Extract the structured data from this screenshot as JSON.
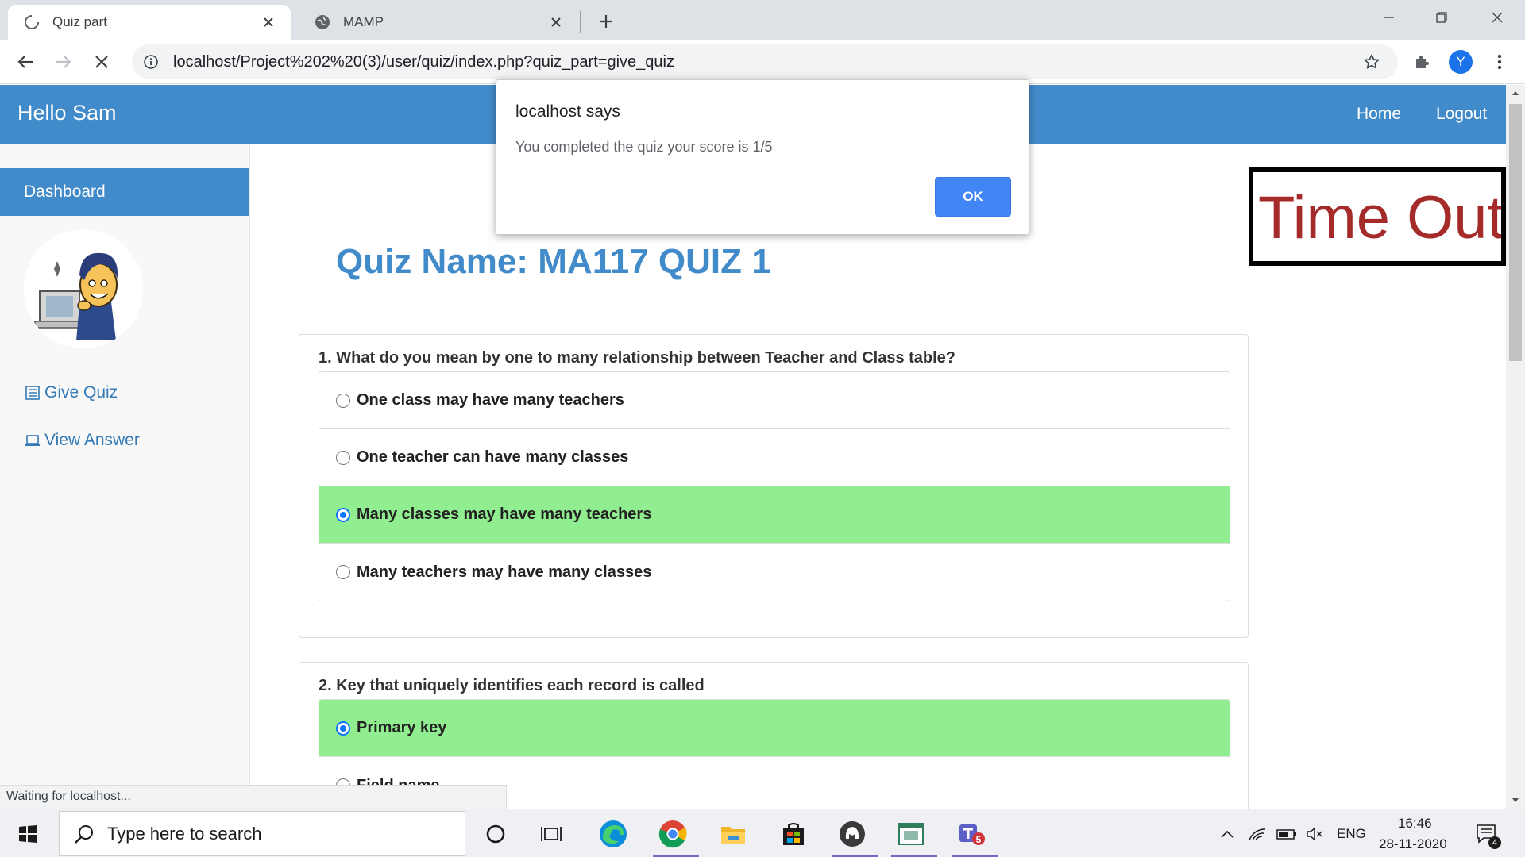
{
  "browser": {
    "tabs": [
      {
        "title": "Quiz part",
        "active": true
      },
      {
        "title": "MAMP",
        "active": false
      }
    ],
    "url": "localhost/Project%202%20(3)/user/quiz/index.php?quiz_part=give_quiz",
    "profile_initial": "Y",
    "status_text": "Waiting for localhost..."
  },
  "navbar": {
    "brand": "Hello Sam",
    "links": [
      "Home",
      "Logout"
    ]
  },
  "sidebar": {
    "dashboard": "Dashboard",
    "links": [
      "Give Quiz",
      "View Answer"
    ]
  },
  "timer": {
    "text": "Time Out"
  },
  "quiz": {
    "name": "Quiz Name: MA117 QUIZ 1",
    "questions": [
      {
        "text": "1. What do you mean by one to many relationship between Teacher and Class table?",
        "options": [
          {
            "label": "One class may have many teachers",
            "selected": false
          },
          {
            "label": "One teacher can have many classes",
            "selected": false
          },
          {
            "label": "Many classes may have many teachers",
            "selected": true
          },
          {
            "label": "Many teachers may have many classes",
            "selected": false
          }
        ]
      },
      {
        "text": "2. Key that uniquely identifies each record is called",
        "options": [
          {
            "label": "Primary key",
            "selected": true
          },
          {
            "label": "Field name",
            "selected": false
          }
        ]
      }
    ]
  },
  "dialog": {
    "title": "localhost says",
    "message": "You completed the quiz your score is 1/5",
    "ok_label": "OK"
  },
  "taskbar": {
    "search_placeholder": "Type here to search",
    "language": "ENG",
    "time": "16:46",
    "date": "28-11-2020",
    "notification_count": "4",
    "teams_badge": "5"
  },
  "colors": {
    "primary": "#428bca",
    "selected_option": "#90ee90",
    "timeout_text": "#a52a2a",
    "dialog_ok": "#4285f4"
  }
}
